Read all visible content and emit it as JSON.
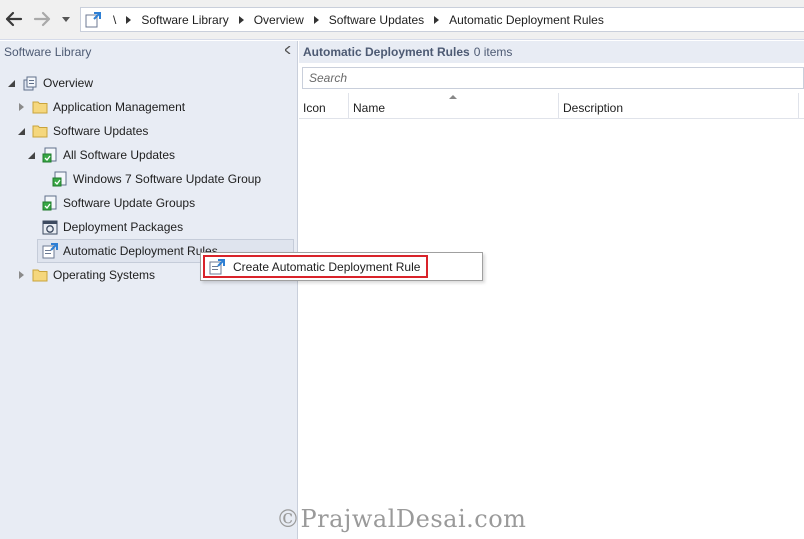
{
  "breadcrumb": {
    "root": "\\",
    "items": [
      "Software Library",
      "Overview",
      "Software Updates",
      "Automatic Deployment Rules"
    ]
  },
  "left_pane": {
    "title": "Software Library",
    "tree": {
      "overview": "Overview",
      "application_management": "Application Management",
      "software_updates": "Software Updates",
      "all_software_updates": "All Software Updates",
      "win7_update_group": "Windows 7 Software Update Group",
      "software_update_groups": "Software Update Groups",
      "deployment_packages": "Deployment Packages",
      "automatic_deployment_rules": "Automatic Deployment Rules",
      "operating_systems": "Operating Systems"
    }
  },
  "right_pane": {
    "title": "Automatic Deployment Rules",
    "count": "0 items",
    "search_placeholder": "Search",
    "columns": [
      "Icon",
      "Name",
      "Description"
    ]
  },
  "context_menu": {
    "items": [
      "Create Automatic Deployment Rule"
    ]
  },
  "watermark": "©PrajwalDesai.com",
  "colors": {
    "pane_bg": "#e8ecf4",
    "header_text": "#4d5a73",
    "highlight_border": "#d9232a",
    "folder": "#e8c25a"
  }
}
